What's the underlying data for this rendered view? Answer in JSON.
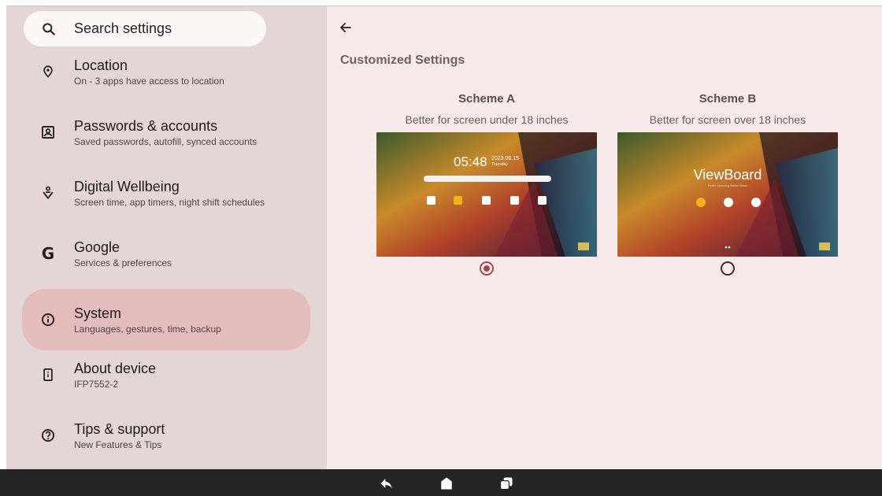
{
  "sidebar": {
    "search_label": "Search settings",
    "items": [
      {
        "title": "Location",
        "subtitle": "On - 3 apps have access to location",
        "icon": "location-pin-icon"
      },
      {
        "title": "Passwords & accounts",
        "subtitle": "Saved passwords, autofill, synced accounts",
        "icon": "account-box-icon"
      },
      {
        "title": "Digital Wellbeing",
        "subtitle": "Screen time, app timers, night shift schedules",
        "icon": "wellbeing-icon"
      },
      {
        "title": "Google",
        "subtitle": "Services & preferences",
        "icon": "google-icon"
      },
      {
        "title": "System",
        "subtitle": "Languages, gestures, time, backup",
        "icon": "info-icon",
        "selected": true
      },
      {
        "title": "About device",
        "subtitle": "IFP7552-2",
        "icon": "device-icon"
      },
      {
        "title": "Tips & support",
        "subtitle": "New Features & Tips",
        "icon": "help-icon"
      }
    ]
  },
  "main": {
    "heading": "Customized Settings",
    "schemes": [
      {
        "name": "Scheme A",
        "description": "Better for screen under 18 inches",
        "selected": true,
        "preview": {
          "time": "05:48",
          "date": "2023.06.15",
          "day": "Thursday"
        }
      },
      {
        "name": "Scheme B",
        "description": "Better for screen over 18 inches",
        "selected": false,
        "preview": {
          "brand": "ViewBoard",
          "tagline": "Better Learning Better Mean"
        }
      }
    ]
  },
  "colors": {
    "sidebar_bg": "#e5d6d6",
    "selected_bg": "#e5bcbc",
    "content_bg": "#f8eaea",
    "radio_accent": "#a64b4b",
    "navbar_bg": "#252525"
  }
}
